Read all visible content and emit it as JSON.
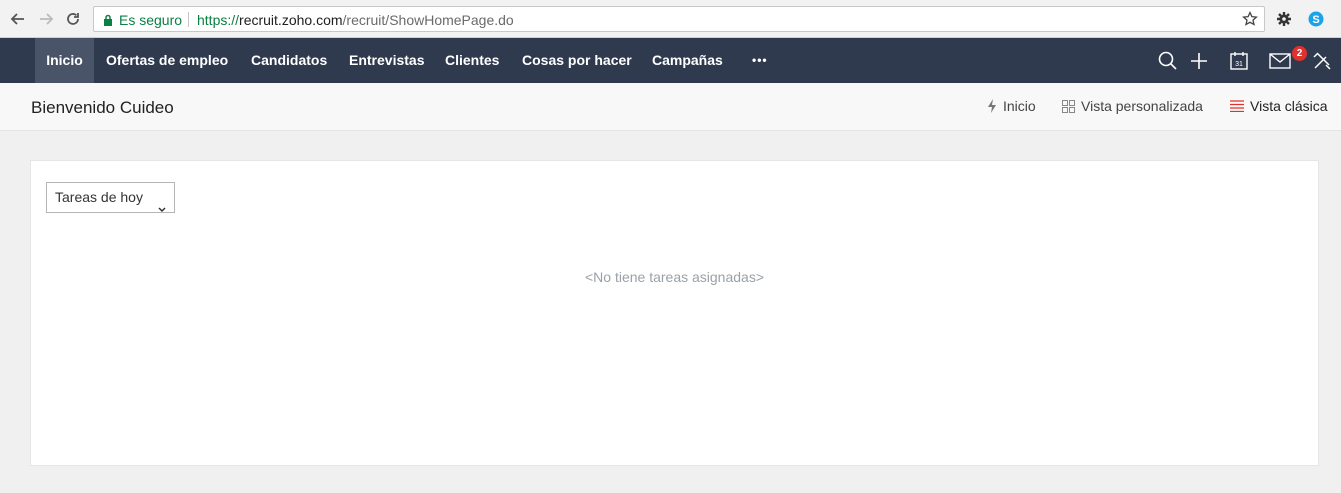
{
  "browser": {
    "secure_label": "Es seguro",
    "url_scheme": "https://",
    "url_host": "recruit.zoho.com",
    "url_path": "/recruit/ShowHomePage.do"
  },
  "nav": {
    "items": [
      {
        "label": "Inicio",
        "active": true
      },
      {
        "label": "Ofertas de empleo"
      },
      {
        "label": "Candidatos"
      },
      {
        "label": "Entrevistas"
      },
      {
        "label": "Clientes"
      },
      {
        "label": "Cosas por hacer"
      },
      {
        "label": "Campañas"
      }
    ],
    "more_label": "•••",
    "mail_badge": "2",
    "calendar_day": "31"
  },
  "subheader": {
    "welcome": "Bienvenido Cuideo",
    "links": {
      "inicio": "Inicio",
      "custom": "Vista personalizada",
      "classic": "Vista clásica"
    }
  },
  "panel": {
    "select_value": "Tareas de hoy",
    "empty_message": "<No tiene tareas asignadas>"
  },
  "colors": {
    "nav_bg": "#303a4e",
    "nav_active": "#4a5468",
    "badge": "#e0322c",
    "secure": "#0b8043"
  }
}
